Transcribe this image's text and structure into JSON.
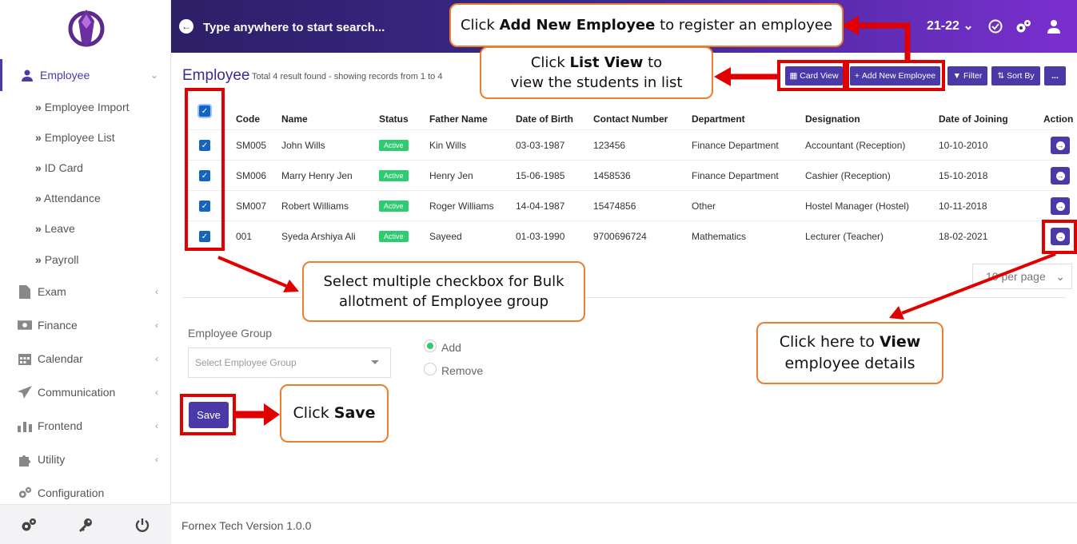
{
  "header": {
    "search_placeholder": "Type anywhere to start search...",
    "session": "21-22"
  },
  "sidebar": {
    "items": [
      {
        "label": "Employee",
        "icon": "user-icon",
        "active": true
      },
      {
        "label": "Exam",
        "icon": "document-icon"
      },
      {
        "label": "Finance",
        "icon": "money-icon"
      },
      {
        "label": "Calendar",
        "icon": "calendar-icon"
      },
      {
        "label": "Communication",
        "icon": "send-icon"
      },
      {
        "label": "Frontend",
        "icon": "bar-chart-icon"
      },
      {
        "label": "Utility",
        "icon": "puzzle-icon"
      },
      {
        "label": "Configuration",
        "icon": "gears-icon"
      }
    ],
    "submenu": [
      "Employee Import",
      "Employee List",
      "ID Card",
      "Attendance",
      "Leave",
      "Payroll"
    ]
  },
  "page": {
    "title": "Employee",
    "subtitle": "Total 4 result found - showing records from 1 to 4"
  },
  "toolbar": {
    "card_view": "Card View",
    "add_new": "Add New Employee",
    "filter": "Filter",
    "sort_by": "Sort By",
    "more": "..."
  },
  "table": {
    "columns": [
      "Code",
      "Name",
      "Status",
      "Father Name",
      "Date of Birth",
      "Contact Number",
      "Department",
      "Designation",
      "Date of Joining",
      "Action"
    ],
    "rows": [
      {
        "code": "SM005",
        "name": "John Wills",
        "status": "Active",
        "father": "Kin Wills",
        "dob": "03-03-1987",
        "contact": "123456",
        "dept": "Finance Department",
        "designation": "Accountant (Reception)",
        "doj": "10-10-2010"
      },
      {
        "code": "SM006",
        "name": "Marry Henry Jen",
        "status": "Active",
        "father": "Henry Jen",
        "dob": "15-06-1985",
        "contact": "1458536",
        "dept": "Finance Department",
        "designation": "Cashier (Reception)",
        "doj": "15-10-2018"
      },
      {
        "code": "SM007",
        "name": "Robert Williams",
        "status": "Active",
        "father": "Roger Williams",
        "dob": "14-04-1987",
        "contact": "15474856",
        "dept": "Other",
        "designation": "Hostel Manager (Hostel)",
        "doj": "10-11-2018"
      },
      {
        "code": "001",
        "name": "Syeda Arshiya Ali",
        "status": "Active",
        "father": "Sayeed",
        "dob": "01-03-1990",
        "contact": "9700696724",
        "dept": "Mathematics",
        "designation": "Lecturer (Teacher)",
        "doj": "18-02-2021"
      }
    ],
    "per_page": "10 per page"
  },
  "form": {
    "group_label": "Employee Group",
    "group_placeholder": "Select Employee Group",
    "add_label": "Add",
    "remove_label": "Remove",
    "save_label": "Save"
  },
  "footer": {
    "version": "Fornex Tech Version 1.0.0"
  },
  "callouts": {
    "add_new_pre": "Click ",
    "add_new_bold": "Add New Employee",
    "add_new_post": " to register an employee",
    "list_view_pre": "Click ",
    "list_view_bold": "List View",
    "list_view_post": " to",
    "list_view_line2": "view the students in list",
    "bulk_line1": "Select multiple checkbox for Bulk",
    "bulk_line2": "allotment of Employee group",
    "view_pre": "Click here to ",
    "view_bold": "View",
    "view_line2": "employee details",
    "save_pre": "Click ",
    "save_bold": "Save"
  },
  "colors": {
    "primary": "#4a3aa8",
    "active_badge": "#2ecc71",
    "highlight": "#e00000",
    "callout_border": "#ed7d31"
  }
}
